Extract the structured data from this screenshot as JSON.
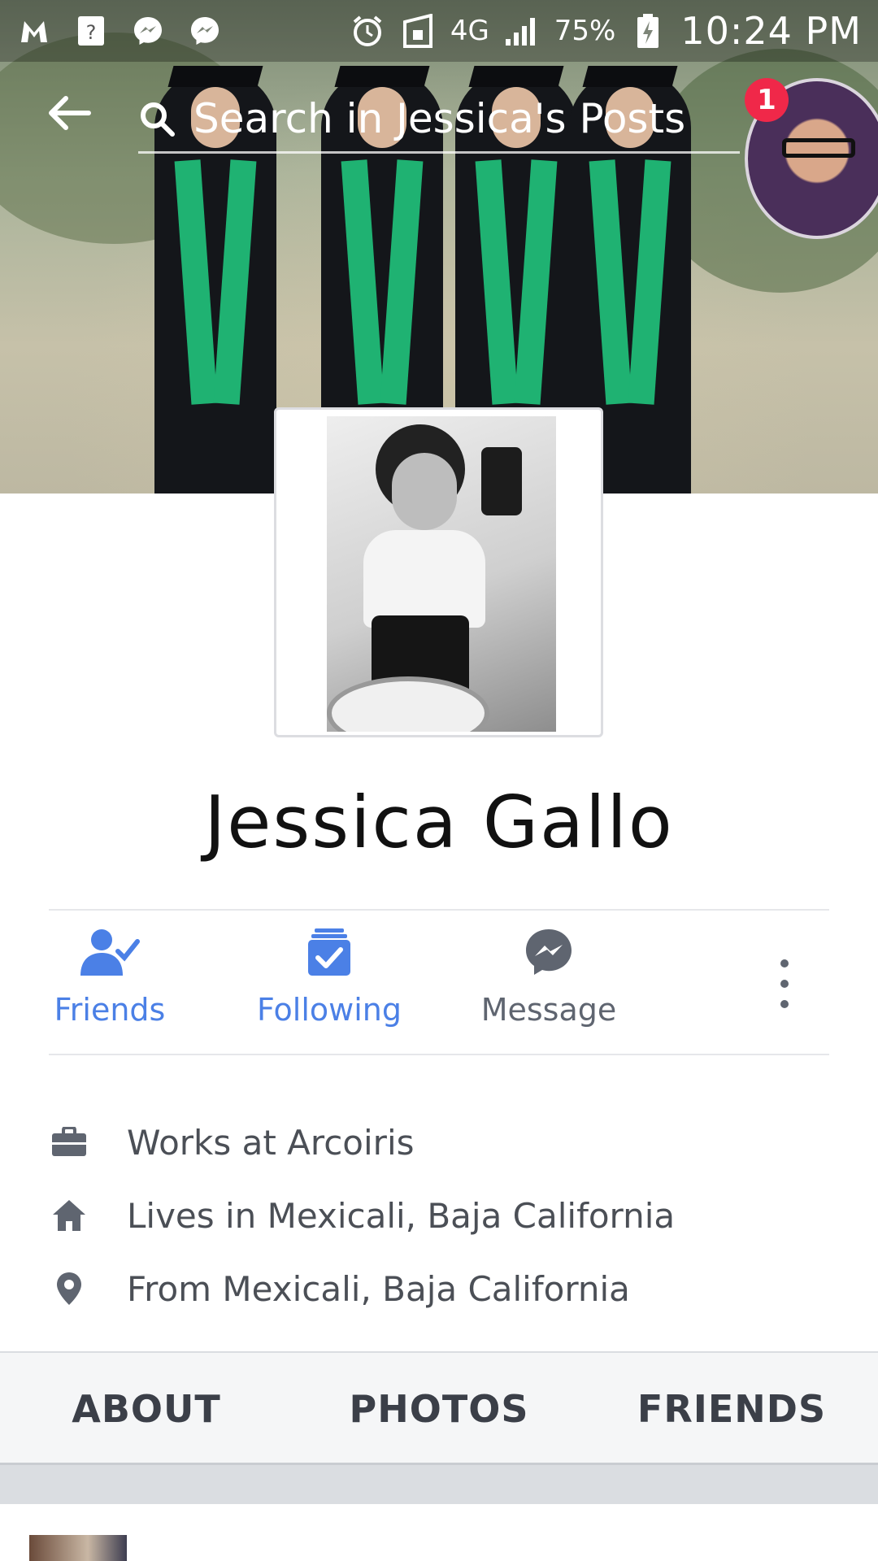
{
  "status_bar": {
    "battery": "75%",
    "network": "4G",
    "time": "10:24 PM"
  },
  "search": {
    "placeholder": "Search in Jessica's Posts"
  },
  "notifications": {
    "badge_count": "1"
  },
  "profile": {
    "name": "Jessica Gallo"
  },
  "actions": {
    "friends": "Friends",
    "following": "Following",
    "message": "Message"
  },
  "info": [
    {
      "icon": "briefcase-icon",
      "text": "Works at Arcoiris"
    },
    {
      "icon": "home-icon",
      "text": "Lives in Mexicali, Baja California"
    },
    {
      "icon": "location-pin-icon",
      "text": "From Mexicali, Baja California"
    }
  ],
  "tabs": {
    "about": "ABOUT",
    "photos": "PHOTOS",
    "friends": "FRIENDS"
  },
  "colors": {
    "accent_blue": "#4b80e6",
    "icon_gray": "#5f6570",
    "badge_red": "#f02849"
  }
}
